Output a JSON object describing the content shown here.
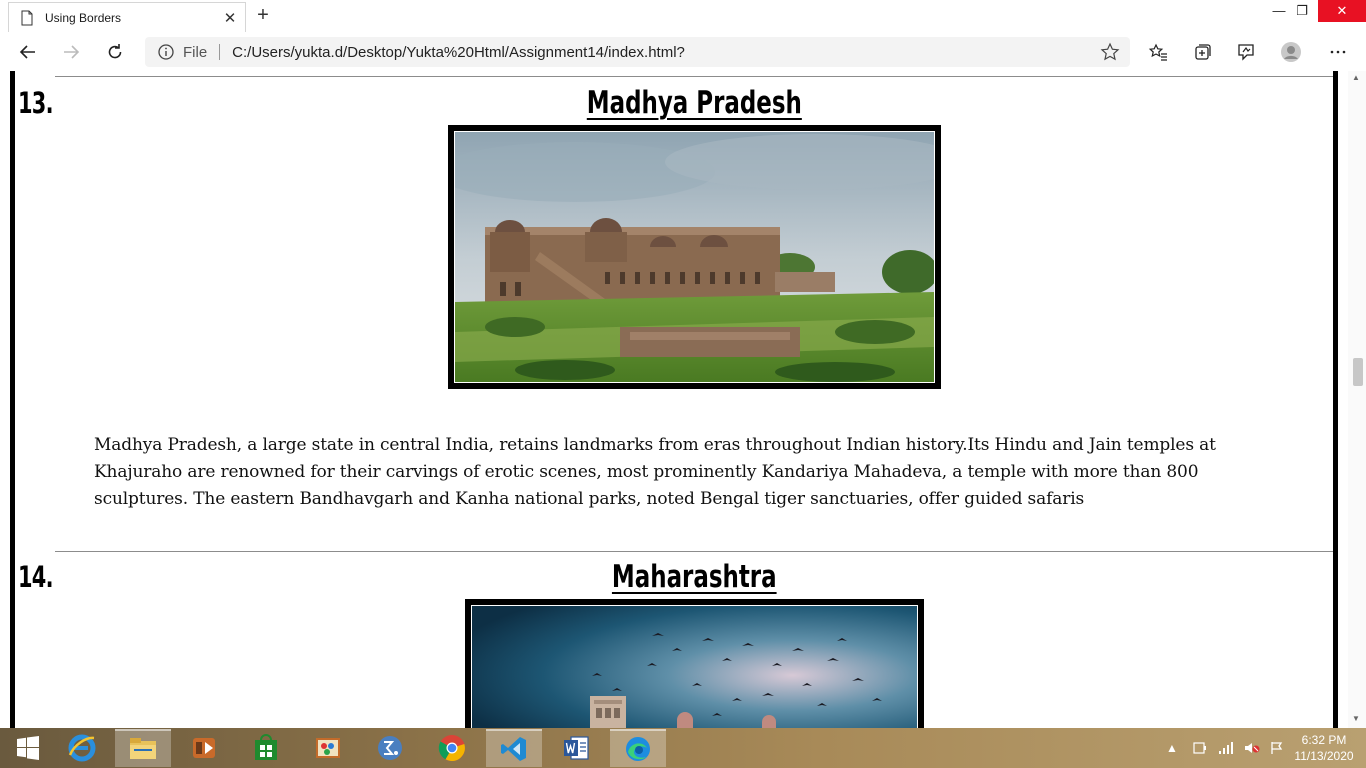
{
  "browser": {
    "tab_title": "Using Borders",
    "tab_close_glyph": "✕",
    "new_tab_glyph": "+",
    "window_minimize": "—",
    "window_restore": "❐",
    "window_close": "✕",
    "address": {
      "scheme_label": "File",
      "url": "C:/Users/yukta.d/Desktop/Yukta%20Html/Assignment14/index.html?"
    }
  },
  "page": {
    "sections": [
      {
        "number": "13.",
        "title": "Madhya Pradesh",
        "image_subject": "Jahaz Mahal palace at Mandu with green lawns under cloudy sky",
        "description": "Madhya Pradesh, a large state in central India, retains landmarks from eras throughout Indian history.Its Hindu and Jain temples at Khajuraho are renowned for their carvings of erotic scenes, most prominently Kandariya Mahadeva, a temple with more than 800 sculptures. The eastern Bandhavgarh and Kanha national parks, noted Bengal tiger sanctuaries, offer guided safaris"
      },
      {
        "number": "14.",
        "title": "Maharashtra",
        "image_subject": "Gateway of India with birds flying against a blue evening sky"
      }
    ]
  },
  "taskbar": {
    "apps": [
      "windows-start-icon",
      "internet-explorer-icon",
      "file-explorer-icon",
      "media-player-icon",
      "store-icon",
      "paint-icon",
      "math-input-icon",
      "chrome-icon",
      "vscode-icon",
      "word-icon",
      "edge-icon"
    ],
    "clock": {
      "time": "6:32 PM",
      "date": "11/13/2020"
    }
  },
  "colors": {
    "page_frame": "#000000",
    "close_button": "#e81123",
    "taskbar": "#8a7148"
  }
}
